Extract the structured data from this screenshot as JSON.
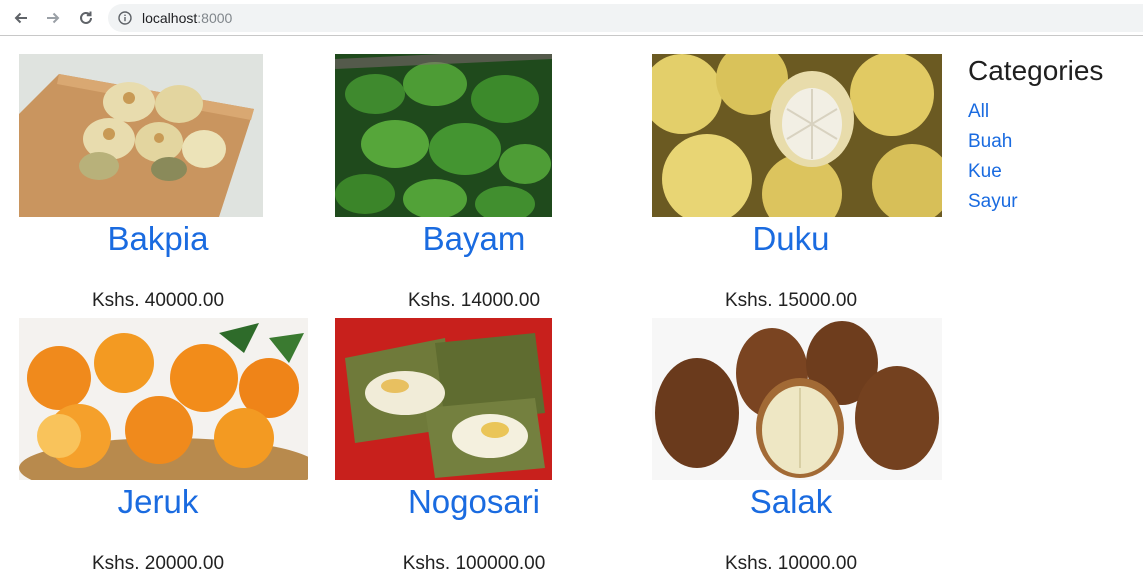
{
  "browser": {
    "url_host": "localhost",
    "url_port": ":8000"
  },
  "products": [
    {
      "name": "Bakpia",
      "price": "Kshs. 40000.00",
      "image": "bakpia-photo"
    },
    {
      "name": "Bayam",
      "price": "Kshs. 14000.00",
      "image": "bayam-photo"
    },
    {
      "name": "Duku",
      "price": "Kshs. 15000.00",
      "image": "duku-photo"
    },
    {
      "name": "Jeruk",
      "price": "Kshs. 20000.00",
      "image": "jeruk-photo"
    },
    {
      "name": "Nogosari",
      "price": "Kshs. 100000.00",
      "image": "nogosari-photo"
    },
    {
      "name": "Salak",
      "price": "Kshs. 10000.00",
      "image": "salak-photo"
    }
  ],
  "categories": {
    "title": "Categories",
    "items": [
      "All",
      "Buah",
      "Kue",
      "Sayur"
    ]
  },
  "colors": {
    "link": "#1a6be0",
    "text": "#222222"
  }
}
